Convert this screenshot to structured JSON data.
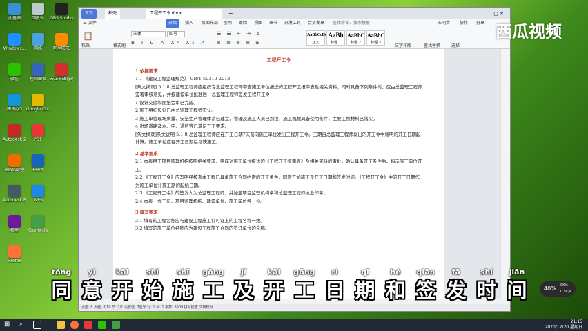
{
  "desktop_icons": [
    {
      "label": "此电脑",
      "color": "#3b8fd6"
    },
    {
      "label": "回收站",
      "color": "#bfc7cf"
    },
    {
      "label": "OBS Studio",
      "color": "#222"
    },
    {
      "label": "Windows...",
      "color": "#1e90ff"
    },
    {
      "label": "网络",
      "color": "#4aa3e0"
    },
    {
      "label": "阿里旺旺",
      "color": "#ff8c00"
    },
    {
      "label": "微信",
      "color": "#2dc100"
    },
    {
      "label": "控制面板",
      "color": "#3566b8"
    },
    {
      "label": "天正市政管理...",
      "color": "#d32f2f"
    },
    {
      "label": "腾讯QQ",
      "color": "#1296db"
    },
    {
      "label": "Google Chrome",
      "color": "#e6b800"
    },
    {
      "label": "360安全卫士",
      "color": "#5cb85c"
    },
    {
      "label": "Autodesk 2010",
      "color": "#c62828"
    },
    {
      "label": "PDF",
      "color": "#e53935"
    },
    {
      "label": "Revit",
      "color": "#1565c0"
    },
    {
      "label": "福昕阅读器",
      "color": "#ef6c00"
    },
    {
      "label": "Revit",
      "color": "#1565c0"
    },
    {
      "label": "CAD",
      "color": "#c62828"
    },
    {
      "label": "Autodesk ReCap",
      "color": "#455a64"
    },
    {
      "label": "WPS",
      "color": "#1e88e5"
    },
    {
      "label": "Lumion",
      "color": "#37474f"
    },
    {
      "label": "模型",
      "color": "#6a1b9a"
    },
    {
      "label": "Camtasia",
      "color": "#43a047"
    },
    {
      "label": "视频",
      "color": "#e91e63"
    },
    {
      "label": "Firefox",
      "color": "#ff7139"
    }
  ],
  "window": {
    "tabs": [
      "首页",
      "稻壳",
      "工程开工令.docx"
    ],
    "menu": [
      "三 文件",
      "开始",
      "插入",
      "页面布局",
      "引用",
      "审阅",
      "视图",
      "章节",
      "开发工具",
      "会员专享",
      "查找命令、搜索模板"
    ],
    "right_menu": [
      "未同步",
      "协作",
      "分享"
    ],
    "font_name": "宋体",
    "font_size": "四号",
    "styles": [
      {
        "sample": "AaBbCcDd",
        "name": "正文"
      },
      {
        "sample": "AaBb",
        "name": "标题 1"
      },
      {
        "sample": "AaBbC",
        "name": "标题 2"
      },
      {
        "sample": "AaBbC",
        "name": "标题 3"
      }
    ],
    "tool_labels": [
      "粘贴",
      "格式刷",
      "文字排版",
      "查找替换",
      "选择"
    ],
    "status": "页面: 8  页面: 8/10  节: 1/1  设置值: 7厘米  行: 1  列: 1  字数: 3909  拼写检查  文档校对"
  },
  "document": {
    "title": "工程开工令",
    "sec1": "1  依据要求",
    "p1": "1.1  《建设工程监理规范》  GB/T 50319-2013",
    "p2": "[条文摘录] 5.1.8 总监理工程师应组织专业监理工程师审查施工单位报送的工程开工报审表及相关资料；同时具备下列条件时，应由总监理工程师签署审核意见，并报建设单位批准后，总监理工程师签发工程开工令：",
    "p3": "1 设计交底和图纸会审已完成。",
    "p4": "2 施工组织设计已由总监理工程师签认。",
    "p5": "3 施工单位现场质量、安全生产管理体系已建立，管理及施工人员已到位，施工机械具备使用条件，主要工程材料已落实。",
    "p6": "4 进场道路及水、电、通信等已满足开工要求。",
    "p7": "[条文摘录]条文说明 5.1.8 总监理工程师应在开工日期7天前向施工单位发出工程开工令。工期自总监理工程师发出的开工令中载明的开工日期起计算。施工单位应在开工日期后尽快施工。",
    "sec2": "2  基本要求",
    "p8": "2.1  本表用于项目监理机构按照相关要求，完成对施工单位报送的《工程开工报审表》及相关资料的审批，确认具备开工条件后，指示施工单位开工。",
    "p9": "2.2  《工程开工令》应写明经核查本工程已具备施工合同约定的开工条件，同意开始施工及开工日期和签发时间。《工程开工令》中的开工日期作为施工单位计算工期的起始日期。",
    "p10": "2.3  《工程开工令》的签发人为总监理工程师，并加盖项目监理机构章和总监理工程师执业印章。",
    "p11": "2.4  本表一式三份，项目监理机构、建设单位、施工单位各一份。",
    "sec3": "3  填写要求",
    "p12": "3.1  填写的工程名称应与建设工程施工许可证上的工程名称一致。",
    "p13": "3.2  填写的施工单位名称应为建设工程施工合同的签订单位的全称。"
  },
  "subtitle": [
    {
      "py": "tóng",
      "hz": "同"
    },
    {
      "py": "yì",
      "hz": "意"
    },
    {
      "py": "kāi",
      "hz": "开"
    },
    {
      "py": "shǐ",
      "hz": "始"
    },
    {
      "py": "shī",
      "hz": "施"
    },
    {
      "py": "gōng",
      "hz": "工"
    },
    {
      "py": "jí",
      "hz": "及"
    },
    {
      "py": "kāi",
      "hz": "开"
    },
    {
      "py": "gōng",
      "hz": "工"
    },
    {
      "py": "rì",
      "hz": "日"
    },
    {
      "py": "qī",
      "hz": "期"
    },
    {
      "py": "hé",
      "hz": "和"
    },
    {
      "py": "qiān",
      "hz": "签"
    },
    {
      "py": "fā",
      "hz": "发"
    },
    {
      "py": "shí",
      "hz": "时"
    },
    {
      "py": "jiān",
      "hz": "间"
    }
  ],
  "watermark": "西瓜视频",
  "net": {
    "percent": "40%",
    "up": "0K/s",
    "down": "0.5K/s"
  },
  "clock": {
    "time": "21:15",
    "date": "2020/12/20 星期日"
  }
}
